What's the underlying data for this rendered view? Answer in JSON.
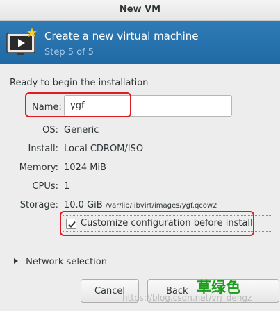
{
  "window": {
    "title": "New VM"
  },
  "banner": {
    "title": "Create a new virtual machine",
    "step": "Step 5 of 5",
    "icon": "vm-screen-icon"
  },
  "summary": {
    "heading": "Ready to begin the installation",
    "name_label": "Name:",
    "name_value": "ygf",
    "os_label": "OS:",
    "os_value": "Generic",
    "install_label": "Install:",
    "install_value": "Local CDROM/ISO",
    "memory_label": "Memory:",
    "memory_value": "1024 MiB",
    "cpus_label": "CPUs:",
    "cpus_value": "1",
    "storage_label": "Storage:",
    "storage_size": "10.0 GiB",
    "storage_path": "/var/lib/libvirt/images/ygf.qcow2"
  },
  "customize": {
    "label": "Customize configuration before install",
    "checked": true
  },
  "network": {
    "label": "Network selection"
  },
  "buttons": {
    "cancel": "Cancel",
    "back": "Back"
  },
  "watermark": {
    "text": "草绿色",
    "url": "https://blog.csdn.net/vrj_dengz"
  },
  "colors": {
    "banner": "#1f6aa5",
    "highlight": "#e01b24",
    "watermark_green": "#1c9b1c"
  }
}
